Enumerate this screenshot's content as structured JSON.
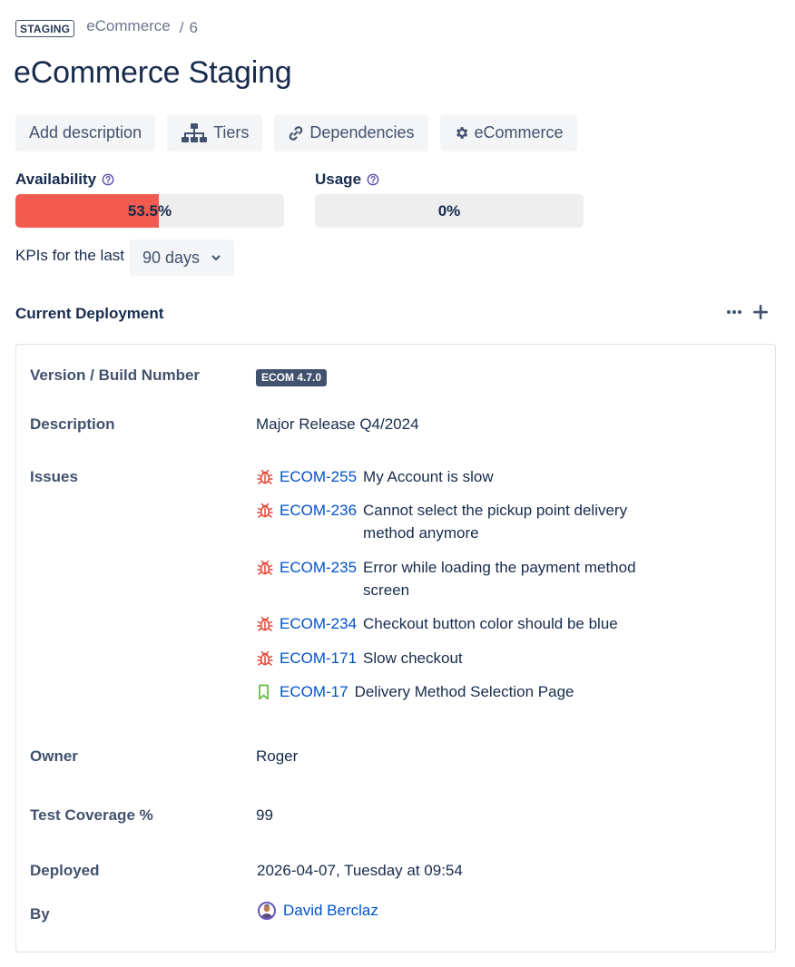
{
  "breadcrumb": {
    "env": "STAGING",
    "parent": "eCommerce",
    "separator": "/",
    "number": "6"
  },
  "title": "eCommerce Staging",
  "toolbar": {
    "add_description": "Add description",
    "tiers": "Tiers",
    "dependencies": "Dependencies",
    "ecommerce": "eCommerce"
  },
  "kpis": {
    "availability": {
      "label": "Availability",
      "value": "53.5%",
      "fraction": 0.535
    },
    "usage": {
      "label": "Usage",
      "value": "0%",
      "fraction": 0
    }
  },
  "kpi_period": {
    "label": "KPIs for the last",
    "selected": "90 days"
  },
  "deployment": {
    "title": "Current Deployment",
    "version_label": "Version / Build Number",
    "version": "ECOM 4.7.0",
    "description_label": "Description",
    "description": "Major Release Q4/2024",
    "issues_label": "Issues",
    "issues": [
      {
        "key": "ECOM-255",
        "summary": "My Account is slow",
        "type": "bug"
      },
      {
        "key": "ECOM-236",
        "summary": "Cannot select the pickup point delivery method anymore",
        "type": "bug"
      },
      {
        "key": "ECOM-235",
        "summary": "Error while loading the payment method screen",
        "type": "bug"
      },
      {
        "key": "ECOM-234",
        "summary": "Checkout button color should be blue",
        "type": "bug"
      },
      {
        "key": "ECOM-171",
        "summary": "Slow checkout",
        "type": "bug"
      },
      {
        "key": "ECOM-17",
        "summary": "Delivery Method Selection Page",
        "type": "story"
      }
    ],
    "owner_label": "Owner",
    "owner": "Roger",
    "coverage_label": "Test Coverage %",
    "coverage": "99",
    "deployed_label": "Deployed",
    "deployed": "2026-04-07, Tuesday at 09:54",
    "by_label": "By",
    "by": "David Berclaz"
  },
  "colors": {
    "accent": "#0052cc",
    "bug": "#e5493a",
    "story": "#63ba3c",
    "availability_bar": "#f15b50",
    "bar_track": "#efeeee"
  },
  "icons": {
    "help": "question-circle-icon",
    "tiers": "hierarchy-icon",
    "dependencies": "link-icon",
    "ecommerce": "gear-icon",
    "chevron": "chevron-down-icon",
    "more": "more-horizontal-icon",
    "add": "plus-icon",
    "bug": "bug-icon",
    "story": "bookmark-icon"
  }
}
